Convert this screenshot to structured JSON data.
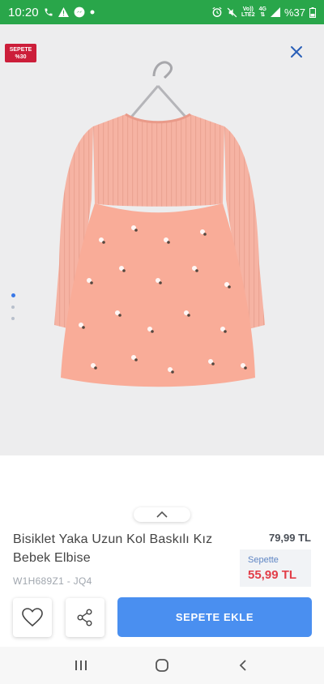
{
  "status_bar": {
    "time": "10:20",
    "network_top": "Vo))",
    "network_bottom": "LTE2",
    "mobile_data": "4G",
    "battery": "%37"
  },
  "product": {
    "sale_badge_line1": "SEPETE",
    "sale_badge_line2": "%30",
    "title": "Bisiklet Yaka Uzun Kol Baskılı Kız Bebek Elbise",
    "code": "W1H689Z1 - JQ4",
    "old_price": "79,99 TL",
    "cart_label": "Sepette",
    "cart_price": "55,99 TL",
    "image_count": 3,
    "active_image": 1
  },
  "actions": {
    "add_to_cart_label": "SEPETE EKLE"
  },
  "colors": {
    "status_bar": "#29a64a",
    "badge": "#cc1e3a",
    "primary_button": "#4a8ff0",
    "cart_price": "#e23d48",
    "dress_top": "#f6b3a3",
    "dress_skirt": "#f9ac98"
  }
}
